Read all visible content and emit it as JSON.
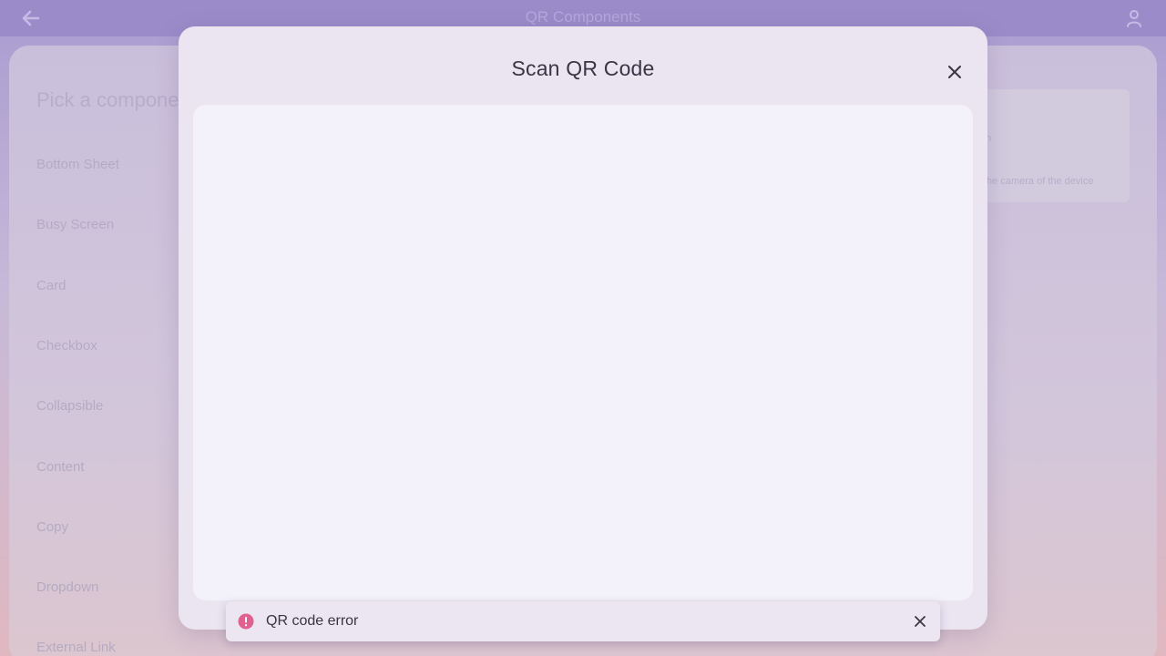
{
  "header": {
    "title": "QR Components",
    "back_icon": "arrow-left-icon",
    "user_icon": "user-icon"
  },
  "background": {
    "heading": "Pick a component",
    "nav_items": [
      "Bottom Sheet",
      "Busy Screen",
      "Card",
      "Checkbox",
      "Collapsible",
      "Content",
      "Copy",
      "Dropdown",
      "External Link"
    ],
    "card": {
      "line1": "n",
      "line2": "the camera of the device"
    }
  },
  "modal": {
    "title": "Scan QR Code",
    "close_icon": "close-icon"
  },
  "toast": {
    "message": "QR code error",
    "icon": "error-icon",
    "icon_color": "#e0608f",
    "close_icon": "close-icon"
  },
  "colors": {
    "header": "#9b8cc9",
    "modal_bg": "#ebe5f1",
    "scanner_bg": "#f3f1f9",
    "text": "#3b3445"
  }
}
